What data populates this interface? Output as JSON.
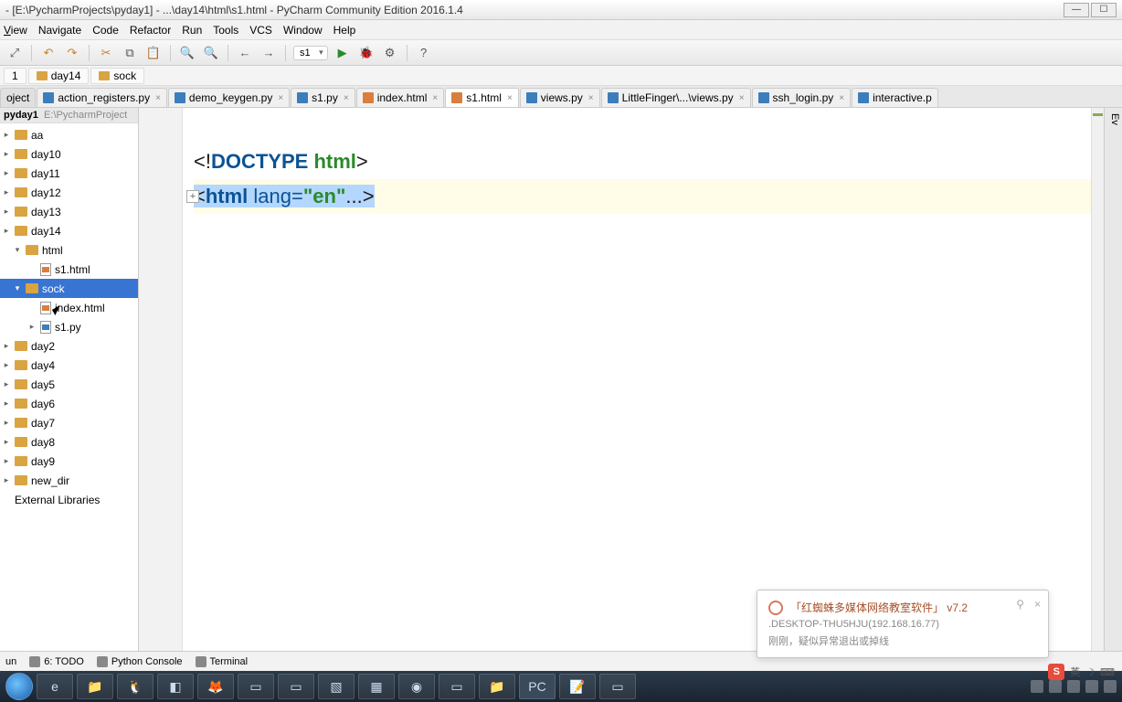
{
  "window": {
    "title": "- [E:\\PycharmProjects\\pyday1] - ...\\day14\\html\\s1.html - PyCharm Community Edition 2016.1.4"
  },
  "menus": {
    "view": "View",
    "navigate": "Navigate",
    "code": "Code",
    "refactor": "Refactor",
    "run": "Run",
    "tools": "Tools",
    "vcs": "VCS",
    "window": "Window",
    "help": "Help"
  },
  "toolbar": {
    "run_config": "s1"
  },
  "breadcrumb": {
    "b1": "1",
    "b2": "day14",
    "b3": "sock"
  },
  "tabs": {
    "t0": "oject",
    "t1": "action_registers.py",
    "t2": "demo_keygen.py",
    "t3": "s1.py",
    "t4": "index.html",
    "t5": "s1.html",
    "t6": "views.py",
    "t7": "LittleFinger\\...\\views.py",
    "t8": "ssh_login.py",
    "t9": "interactive.p"
  },
  "project": {
    "root_name": "pyday1",
    "root_path": "E:\\PycharmProject",
    "items": {
      "aa": "aa",
      "day10": "day10",
      "day11": "day11",
      "day12": "day12",
      "day13": "day13",
      "day14": "day14",
      "html": "html",
      "s1html": "s1.html",
      "sock": "sock",
      "indexhtml": "index.html",
      "s1py": "s1.py",
      "day2": "day2",
      "day4": "day4",
      "day5": "day5",
      "day6": "day6",
      "day7": "day7",
      "day8": "day8",
      "day9": "day9",
      "newdir": "new_dir",
      "extlibs": "External Libraries"
    }
  },
  "editor": {
    "line1_open": "<!",
    "line1_doctype": "DOCTYPE ",
    "line1_html": "html",
    "line1_close": ">",
    "line2_open": "<",
    "line2_tag": "html ",
    "line2_attr": "lang=",
    "line2_val": "\"en\"",
    "line2_ellipsis": "...",
    "line2_close": ">"
  },
  "statusbar": {
    "run": "un",
    "todo": "6: TODO",
    "python_console": "Python Console",
    "terminal": "Terminal",
    "ev": "Ev"
  },
  "notify": {
    "title": "「红蜘蛛多媒体网络教室软件」 v7.2",
    "line1": ".DESKTOP-THU5HJU(192.168.16.77)",
    "line2": "刚刚，疑似异常退出或掉线"
  },
  "tray": {
    "lang": "英",
    "sogou": "S"
  }
}
